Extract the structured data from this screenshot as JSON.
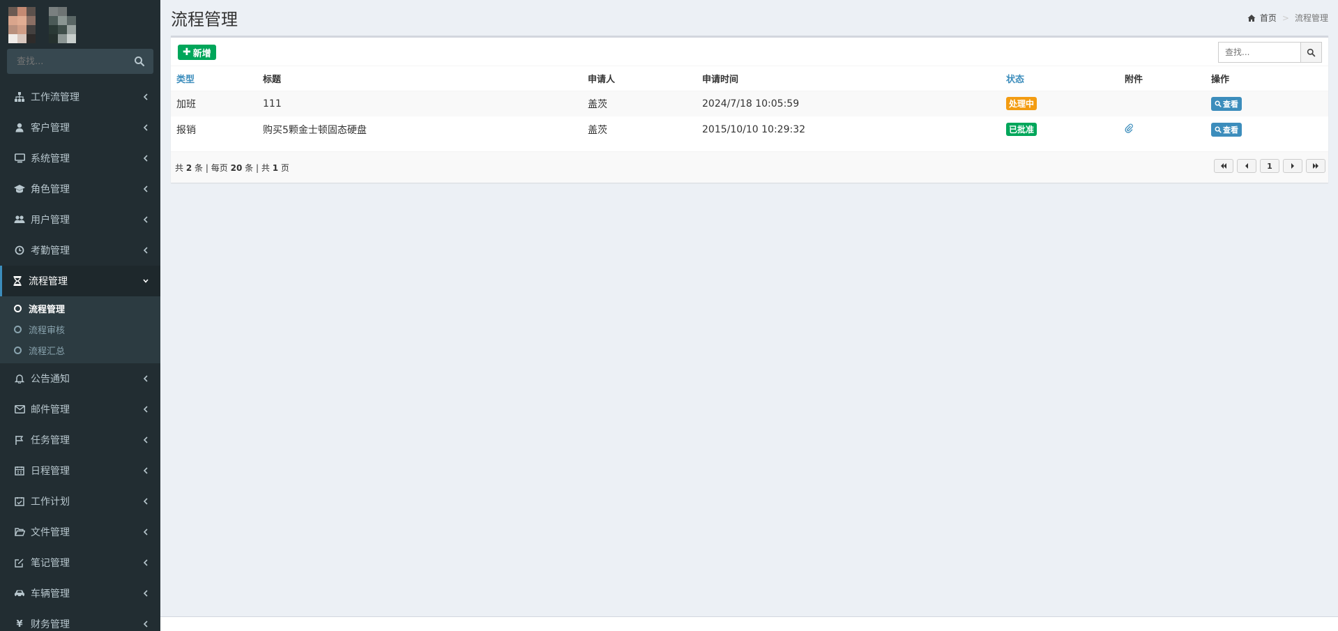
{
  "sidebar": {
    "search_placeholder": "查找...",
    "menu": [
      {
        "label": "工作流管理",
        "icon": "sitemap-icon"
      },
      {
        "label": "客户管理",
        "icon": "user-icon"
      },
      {
        "label": "系统管理",
        "icon": "desktop-icon"
      },
      {
        "label": "角色管理",
        "icon": "graduation-cap-icon"
      },
      {
        "label": "用户管理",
        "icon": "users-icon"
      },
      {
        "label": "考勤管理",
        "icon": "clock-icon"
      },
      {
        "label": "流程管理",
        "icon": "hourglass-icon",
        "active": true
      },
      {
        "label": "公告通知",
        "icon": "bell-icon"
      },
      {
        "label": "邮件管理",
        "icon": "envelope-icon"
      },
      {
        "label": "任务管理",
        "icon": "flag-icon"
      },
      {
        "label": "日程管理",
        "icon": "calendar-icon"
      },
      {
        "label": "工作计划",
        "icon": "calendar-check-icon"
      },
      {
        "label": "文件管理",
        "icon": "folder-open-icon"
      },
      {
        "label": "笔记管理",
        "icon": "edit-icon"
      },
      {
        "label": "车辆管理",
        "icon": "car-icon"
      },
      {
        "label": "财务管理",
        "icon": "yen-icon"
      }
    ],
    "submenu": [
      {
        "label": "流程管理",
        "active": true
      },
      {
        "label": "流程审核"
      },
      {
        "label": "流程汇总"
      }
    ]
  },
  "header": {
    "title": "流程管理",
    "breadcrumb_home": "首页",
    "breadcrumb_sep": ">",
    "breadcrumb_current": "流程管理"
  },
  "toolbar": {
    "add_label": "新增",
    "search_placeholder": "查找..."
  },
  "table": {
    "columns": [
      "类型",
      "标题",
      "申请人",
      "申请时间",
      "状态",
      "附件",
      "操作"
    ],
    "rows": [
      {
        "type": "加班",
        "title": "111",
        "applicant": "盖茨",
        "time": "2024/7/18 10:05:59",
        "status": "处理中",
        "status_color": "#f39c12",
        "attachment": false,
        "action": "查看"
      },
      {
        "type": "报销",
        "title": "购买5颗金士顿固态硬盘",
        "applicant": "盖茨",
        "time": "2015/10/10 10:29:32",
        "status": "已批准",
        "status_color": "#00a65a",
        "attachment": true,
        "action": "查看"
      }
    ]
  },
  "pager": {
    "prefix_total": "共",
    "total": "2",
    "unit_item": "条",
    "sep1": "|",
    "per_page_label": "每页",
    "per_page": "20",
    "unit_item2": "条",
    "sep2": "|",
    "prefix_pages": "共",
    "pages": "1",
    "unit_page": "页",
    "current": "1"
  },
  "colors": {
    "sidebar_bg": "#222d32",
    "accent": "#3c8dbc",
    "success": "#00a65a",
    "warning": "#f39c12"
  }
}
